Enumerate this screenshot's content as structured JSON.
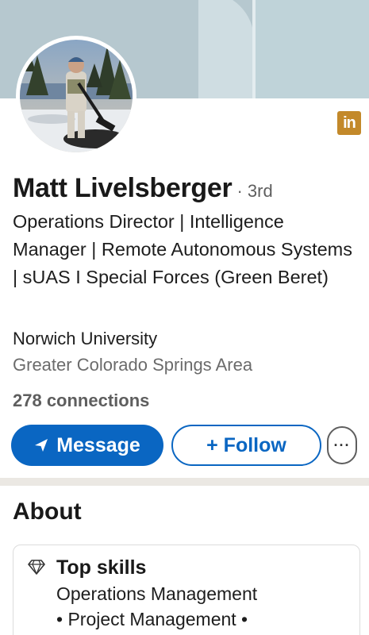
{
  "profile": {
    "name": "Matt Livelsberger",
    "degree": "· 3rd",
    "headline": "Operations Director | Intelligence Manager | Remote Autonomous Systems | sUAS I Special Forces (Green Beret)",
    "school": "Norwich University",
    "location": "Greater Colorado Springs Area",
    "connections": "278 connections"
  },
  "brand": {
    "badge_text": "in",
    "badge_color": "#c3892a",
    "accent": "#0a66c2"
  },
  "actions": {
    "message_label": "Message",
    "message_icon": "send-arrow-icon",
    "follow_label": "+ Follow",
    "more_label": "···"
  },
  "about": {
    "title": "About",
    "top_skills": {
      "title": "Top skills",
      "icon": "diamond-icon",
      "line1": "Operations Management",
      "line2": "• Project Management •"
    }
  }
}
